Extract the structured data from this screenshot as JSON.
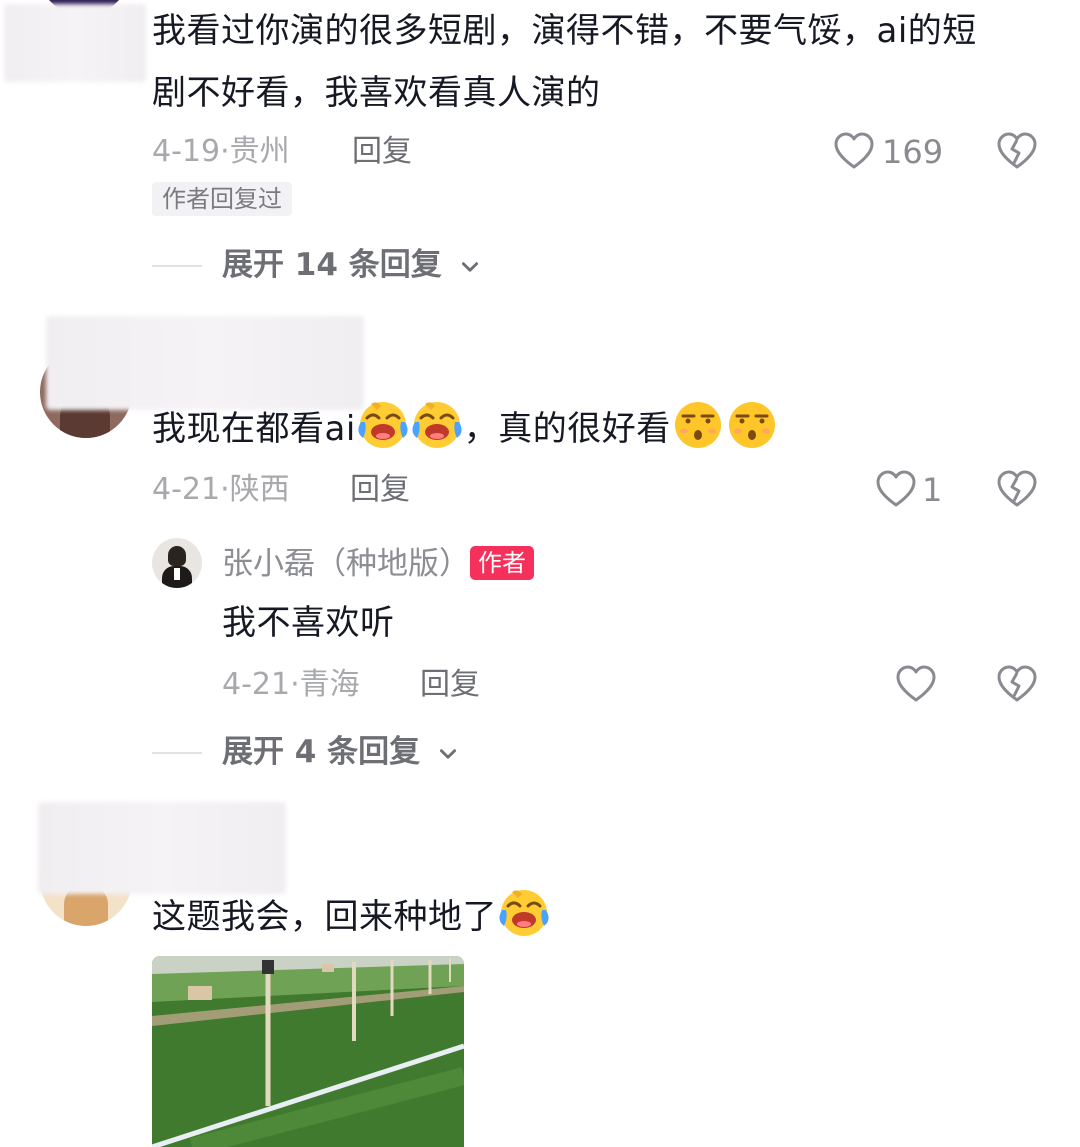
{
  "comments": [
    {
      "text_line1": "我看过你演的很多短剧，演得不错，不要气馁，ai的短",
      "text_line2": "剧不好看，我喜欢看真人演的",
      "date": "4-19·贵州",
      "reply_label": "回复",
      "likes": "169",
      "author_replied_tag": "作者回复过",
      "expand_label": "展开 14 条回复"
    },
    {
      "text_prefix": "我现在都看ai",
      "text_middle": "，真的很好看",
      "date": "4-21·陕西",
      "reply_label": "回复",
      "likes": "1",
      "reply": {
        "author_name": "张小磊（种地版）",
        "author_badge": "作者",
        "text": "我不喜欢听",
        "date": "4-21·青海",
        "reply_label": "回复"
      },
      "expand_label": "展开 4 条回复"
    },
    {
      "text": "这题我会，回来种地了"
    }
  ],
  "icons": {
    "like": "heart-outline-icon",
    "dislike": "broken-heart-icon",
    "expand": "chevron-down-icon",
    "emoji_laugh_cry": "laughing-crying-emoji",
    "emoji_smug": "smug-face-emoji"
  },
  "colors": {
    "author_badge": "#f5305b",
    "muted_text": "#a8a9ad",
    "primary_text": "#161823"
  }
}
